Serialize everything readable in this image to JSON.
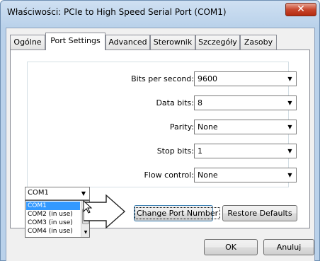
{
  "window": {
    "title": "Właściwości: PCIe to High Speed Serial Port (COM1)",
    "close_glyph": "✕"
  },
  "tabs": [
    {
      "label": "Ogólne"
    },
    {
      "label": "Port Settings"
    },
    {
      "label": "Advanced"
    },
    {
      "label": "Sterownik"
    },
    {
      "label": "Szczegóły"
    },
    {
      "label": "Zasoby"
    }
  ],
  "settings": {
    "bits_per_second": {
      "label": "Bits per second:",
      "value": "9600"
    },
    "data_bits": {
      "label": "Data bits:",
      "value": "8"
    },
    "parity": {
      "label": "Parity:",
      "value": "None"
    },
    "stop_bits": {
      "label": "Stop bits:",
      "value": "1"
    },
    "flow_control": {
      "label": "Flow control:",
      "value": "None"
    }
  },
  "buttons": {
    "change_port": "Change Port Number",
    "restore_defaults": "Restore Defaults",
    "ok": "OK",
    "cancel": "Anuluj"
  },
  "port_combo": {
    "value": "COM1",
    "options": [
      "COM1",
      "COM2 (in use)",
      "COM3 (in use)",
      "COM4 (in use)"
    ],
    "selected": "COM1"
  },
  "icons": {
    "dropdown_arrow": "chevron-down-icon",
    "callout_arrow": "arrow-right-icon",
    "cursor": "mouse-pointer-icon"
  },
  "colors": {
    "selection": "#3399ff",
    "close_button": "#c8472d",
    "title_bar": "#b9d1ea"
  }
}
